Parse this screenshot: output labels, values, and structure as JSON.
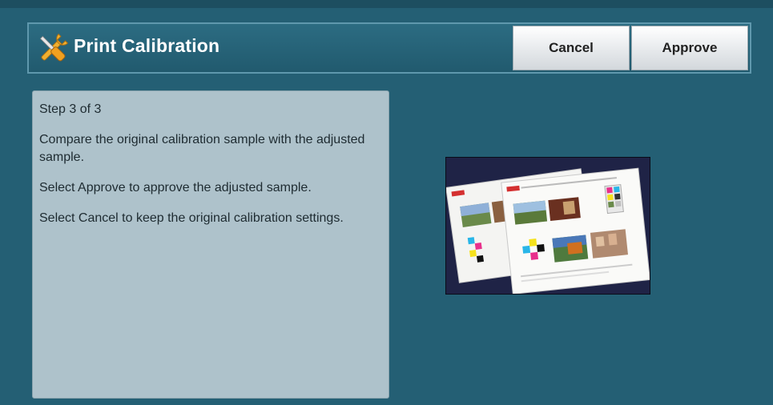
{
  "header": {
    "title": "Print Calibration",
    "cancel_label": "Cancel",
    "approve_label": "Approve",
    "icon": "tools-icon"
  },
  "instructions": {
    "step": "Step 3 of 3",
    "paragraphs": [
      "Compare the original calibration sample with the adjusted sample.",
      "Select Approve to approve the adjusted sample.",
      "Select Cancel to keep the original calibration settings."
    ]
  },
  "sample_image": {
    "icon": "calibration-sample-image"
  },
  "colors": {
    "background": "#245f74",
    "header": "#2c6c82",
    "panel": "#aec2cb",
    "button": "#e4e7ea"
  }
}
